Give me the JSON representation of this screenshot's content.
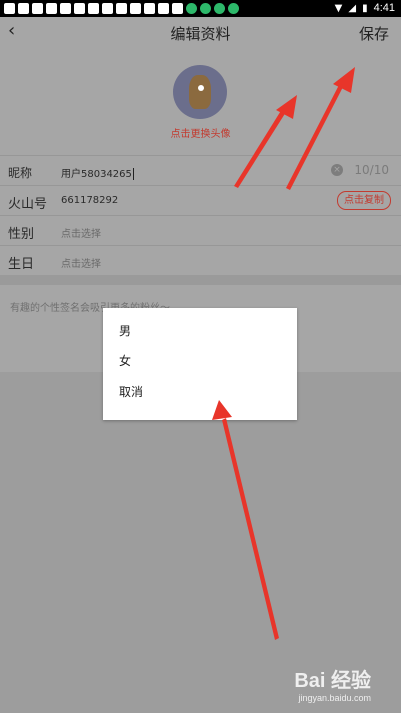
{
  "status": {
    "time": "4:41"
  },
  "nav": {
    "back_icon": "back-chevron-icon",
    "title": "编辑资料",
    "save_label": "保存"
  },
  "avatar": {
    "change_label": "点击更换头像"
  },
  "rows": {
    "nickname": {
      "label": "昵称",
      "value": "用户58034265",
      "count": "10/10",
      "clear_icon": "clear-icon"
    },
    "huoshan_id": {
      "label": "火山号",
      "value": "661178292",
      "copy_label": "点击复制"
    },
    "gender": {
      "label": "性别",
      "placeholder": "点击选择"
    },
    "birthday": {
      "label": "生日",
      "placeholder": "点击选择"
    }
  },
  "signature": {
    "placeholder": "有趣的个性签名会吸引更多的粉丝～"
  },
  "gender_menu": {
    "options": [
      "男",
      "女",
      "取消"
    ]
  },
  "watermark": {
    "main": "Bai 经验",
    "sub": "jingyan.baidu.com"
  },
  "colors": {
    "accent": "#c23b30",
    "arrow": "#e8352a"
  }
}
